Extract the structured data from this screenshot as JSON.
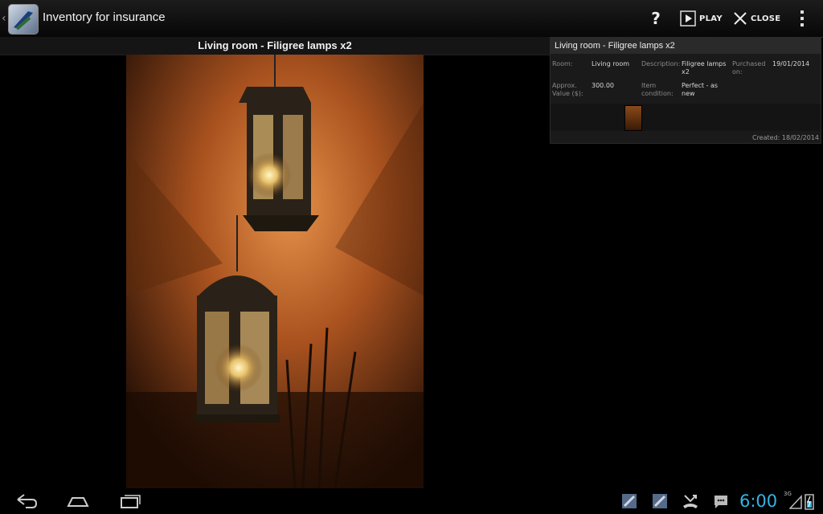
{
  "app": {
    "title": "Inventory for insurance"
  },
  "actions": {
    "help": "?",
    "play": "PLAY",
    "close": "CLOSE"
  },
  "photo": {
    "title": "Living room -  Filigree lamps x2"
  },
  "details": {
    "title": "Living room -  Filigree lamps x2",
    "room_label": "Room:",
    "room_value": "Living room",
    "description_label": "Description:",
    "description_value": "Filigree lamps x2",
    "purchased_label": "Purchased on:",
    "purchased_value": "19/01/2014",
    "value_label": "Approx. Value ($):",
    "value_value": "300.00",
    "condition_label": "Item condition:",
    "condition_value": "Perfect - as new",
    "created": "Created: 18/02/2014"
  },
  "status": {
    "time": "6:00",
    "network": "3G"
  },
  "colors": {
    "accent": "#33b5e5",
    "wall": "#b4612c"
  }
}
